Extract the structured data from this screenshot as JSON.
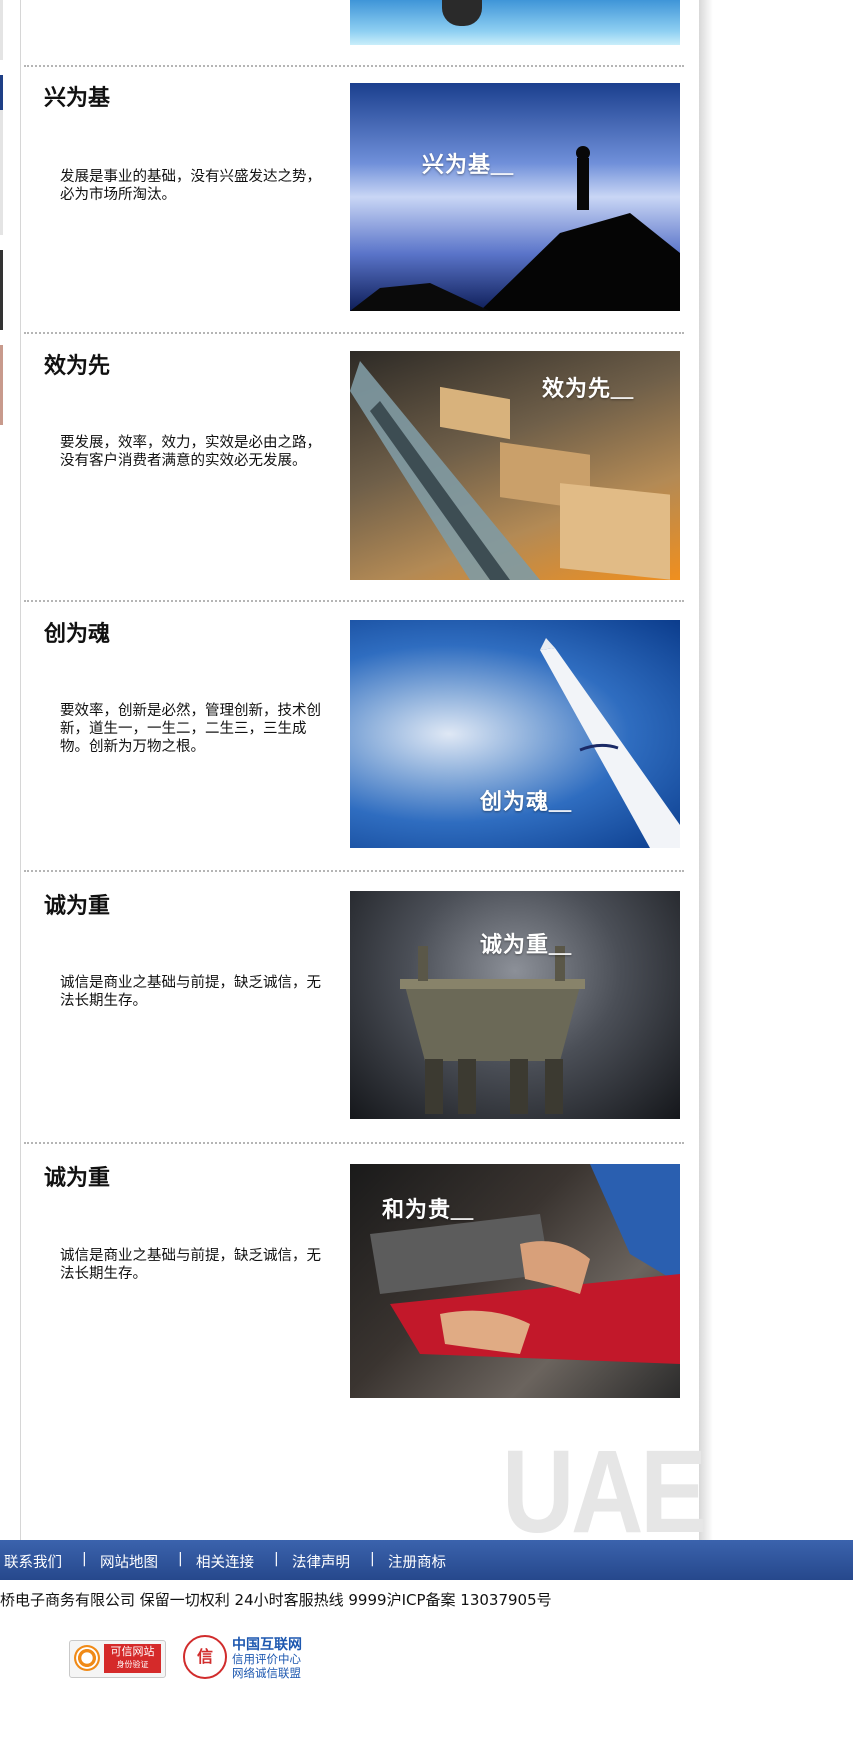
{
  "sections": [
    {
      "title": "兴为基",
      "desc": "发展是事业的基础，没有兴盛发达之势，必为市场所淘汰。",
      "image_caption": "兴为基＿"
    },
    {
      "title": "效为先",
      "desc": "要发展，效率，效力，实效是必由之路，没有客户消费者满意的实效必无发展。",
      "image_caption": "效为先＿"
    },
    {
      "title": "创为魂",
      "desc": "要效率，创新是必然，管理创新，技术创新，道生一，一生二，二生三，三生成物。创新为万物之根。",
      "image_caption": "创为魂＿"
    },
    {
      "title": "诚为重",
      "desc": "诚信是商业之基础与前提，缺乏诚信，无法长期生存。",
      "image_caption": "诚为重＿"
    },
    {
      "title": "诚为重",
      "desc": "诚信是商业之基础与前提，缺乏诚信，无法长期生存。",
      "image_caption": "和为贵＿"
    }
  ],
  "watermark": "UAE",
  "footer": {
    "nav": [
      "联系我们",
      "网站地图",
      "相关连接",
      "法律声明",
      "注册商标"
    ],
    "separator": "|",
    "copyright": "桥电子商务有限公司 保留一切权利 24小时客服热线 9999沪ICP备案 13037905号",
    "badges": {
      "trusted_site": {
        "line1": "可信网站",
        "line2": "身份验证"
      },
      "cnnic": {
        "seal": "信",
        "line1": "中国互联网",
        "line2": "信用评价中心",
        "line3": "网络诚信联盟"
      }
    }
  },
  "colors": {
    "footer_bar": "#2c4f97",
    "watermark": "#e6e6e6",
    "accent_red": "#d12c2c"
  }
}
